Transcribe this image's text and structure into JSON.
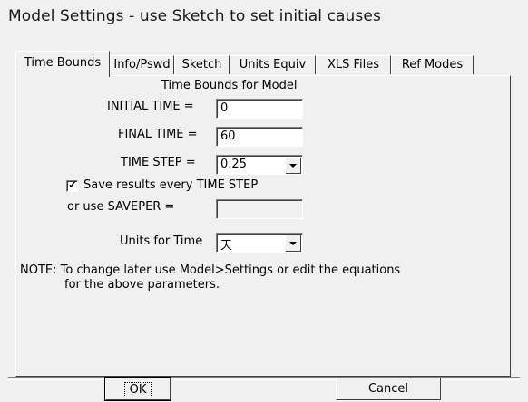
{
  "window": {
    "title": "Model Settings - use Sketch to set initial causes"
  },
  "tabs": [
    {
      "label": "Time Bounds"
    },
    {
      "label": "Info/Pswd"
    },
    {
      "label": "Sketch"
    },
    {
      "label": "Units Equiv"
    },
    {
      "label": "XLS Files"
    },
    {
      "label": "Ref Modes"
    }
  ],
  "panel": {
    "heading": "Time Bounds for Model",
    "initial_time": {
      "label": "INITIAL TIME =",
      "value": "0"
    },
    "final_time": {
      "label": "FINAL TIME =",
      "value": "60"
    },
    "time_step": {
      "label": "TIME STEP =",
      "value": "0.25"
    },
    "save_every": {
      "label": "Save results every TIME STEP",
      "checked": true
    },
    "saveper": {
      "label": "or use SAVEPER =",
      "value": ""
    },
    "units_for_time": {
      "label": "Units for Time",
      "value": "天"
    },
    "note_line1": "NOTE:  To change later use Model>Settings or edit the equations",
    "note_line2": "for the above parameters."
  },
  "buttons": {
    "ok": "OK",
    "cancel": "Cancel"
  }
}
